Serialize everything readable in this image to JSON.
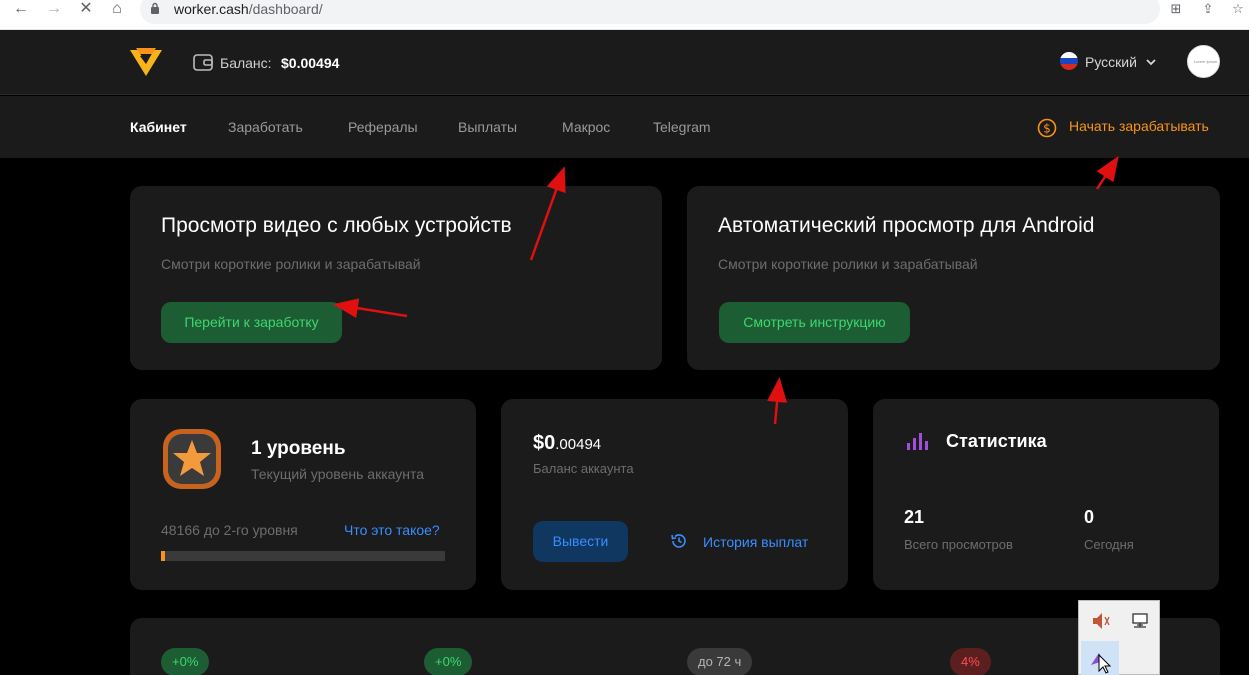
{
  "browser": {
    "url_host": "worker.cash",
    "url_path": "/dashboard/"
  },
  "header": {
    "balance_label": "Баланс:",
    "balance_value": "$0.00494",
    "language": "Русский",
    "avatar_caption": "Lorem Ipsum"
  },
  "nav": {
    "items": [
      "Кабинет",
      "Заработать",
      "Рефералы",
      "Выплаты",
      "Макрос",
      "Telegram"
    ],
    "active_index": 0,
    "cta": "Начать зарабатывать"
  },
  "cards": {
    "video": {
      "title": "Просмотр видео с любых устройств",
      "subtitle": "Смотри короткие ролики и зарабатывай",
      "button": "Перейти к заработку"
    },
    "android": {
      "title": "Автоматический просмотр для Android",
      "subtitle": "Смотри короткие ролики и зарабатывай",
      "button": "Смотреть инструкцию"
    },
    "level": {
      "title": "1 уровень",
      "subtitle": "Текущий уровень аккаунта",
      "progress_label": "48166 до 2-го уровня",
      "link": "Что это такое?",
      "progress_fraction": 0.015
    },
    "balance": {
      "amount_main": "$0",
      "amount_fraction": ".00494",
      "subtitle": "Баланс аккаунта",
      "withdraw": "Вывести",
      "history": "История выплат"
    },
    "stats": {
      "title": "Статистика",
      "total_value": "21",
      "total_label": "Всего просмотров",
      "today_value": "0",
      "today_label": "Сегодня"
    }
  },
  "bottom_pills": [
    "+0%",
    "+0%",
    "до 72 ч",
    "4%"
  ],
  "colors": {
    "accent_orange": "#f7931a",
    "accent_green": "#3fd66f",
    "accent_blue": "#3a8dff",
    "accent_red": "#ff4d4d",
    "card_bg": "#1b1b1b",
    "page_bg": "#000000"
  }
}
